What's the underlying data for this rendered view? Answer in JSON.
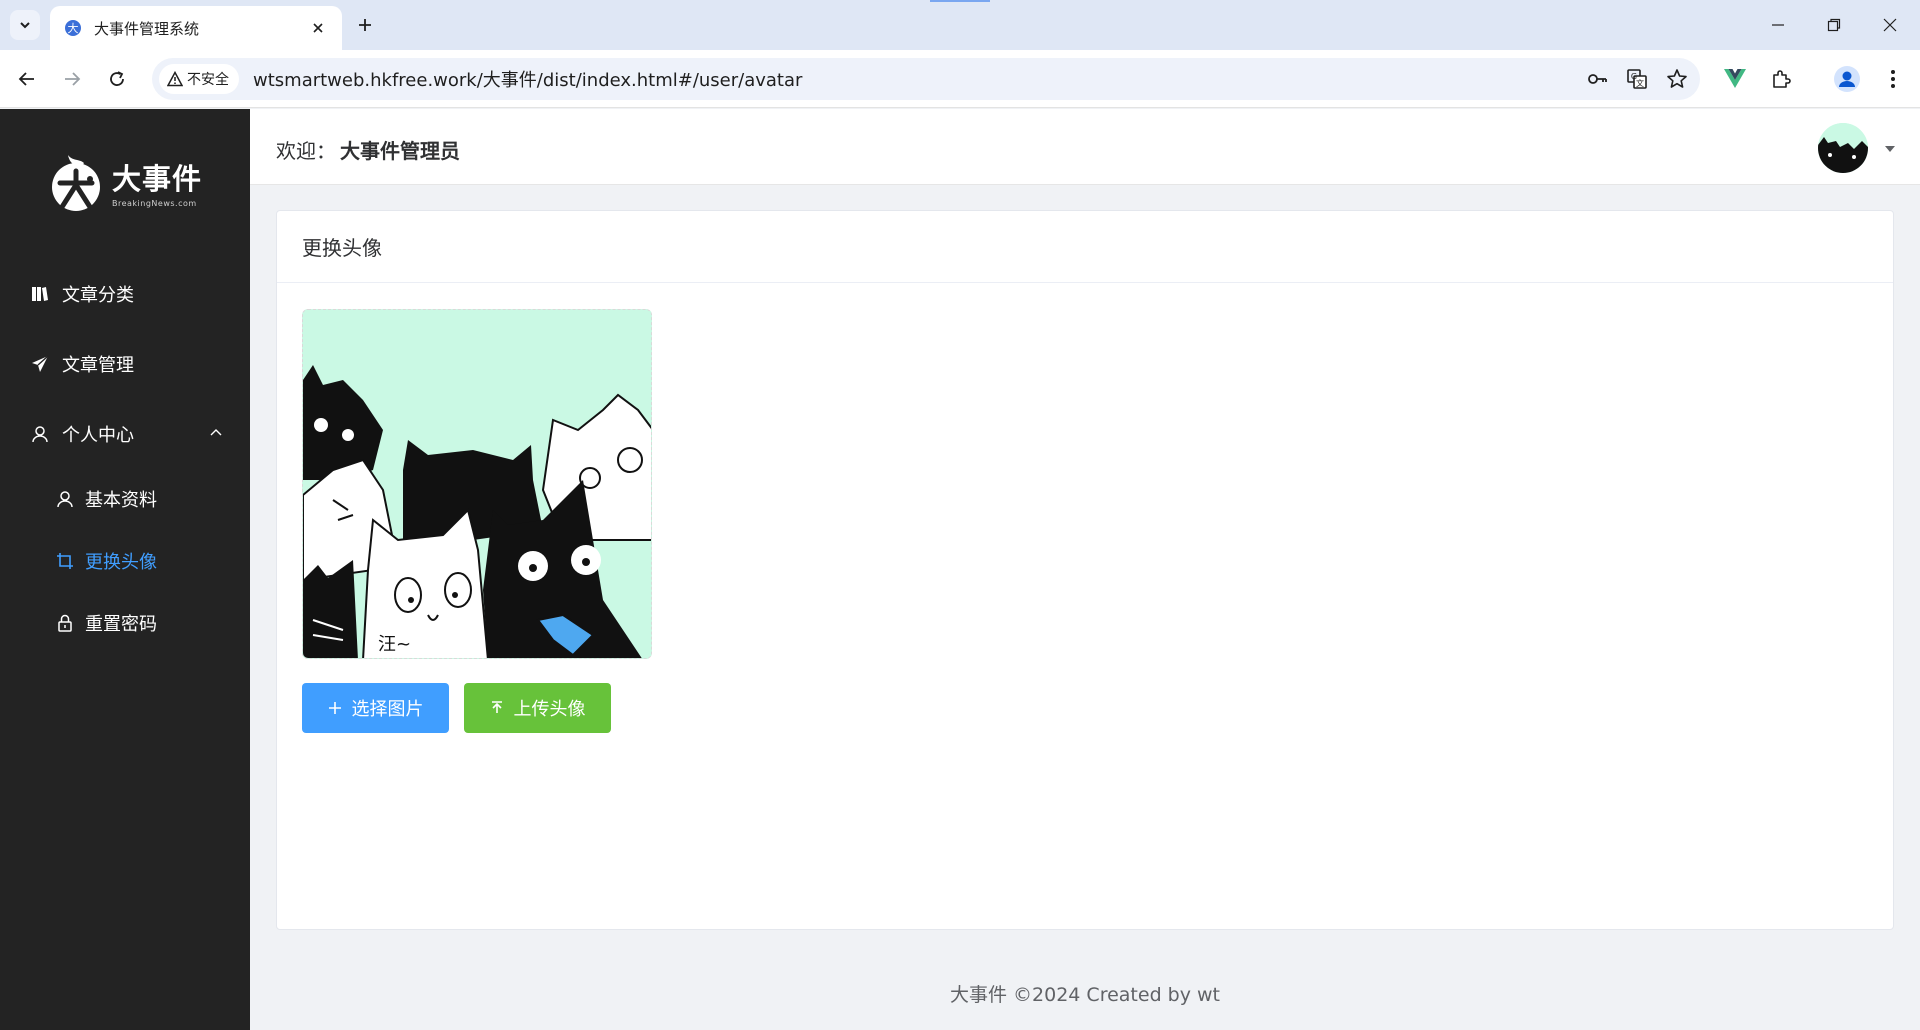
{
  "browser": {
    "tab_title": "大事件管理系统",
    "security_label": "不安全",
    "url": "wtsmartweb.hkfree.work/大事件/dist/index.html#/user/avatar"
  },
  "app": {
    "logo_title": "大事件",
    "logo_sub": "BreakingNews.com",
    "menu": [
      {
        "label": "文章分类",
        "icon": "book-icon"
      },
      {
        "label": "文章管理",
        "icon": "paper-plane-icon"
      },
      {
        "label": "个人中心",
        "icon": "user-icon",
        "expanded": true
      }
    ],
    "submenu": [
      {
        "label": "基本资料",
        "icon": "user-icon"
      },
      {
        "label": "更换头像",
        "icon": "crop-icon",
        "active": true
      },
      {
        "label": "重置密码",
        "icon": "lock-icon"
      }
    ],
    "header": {
      "welcome_prefix": "欢迎：",
      "username": "大事件管理员"
    },
    "card": {
      "title": "更换头像",
      "select_button": "选择图片",
      "upload_button": "上传头像"
    },
    "footer": "大事件 ©2024 Created by wt"
  },
  "colors": {
    "sidebar_bg": "#232323",
    "active": "#409eff",
    "primary_button": "#409eff",
    "success_button": "#67c23a",
    "avatar_bg": "#caf9e4"
  }
}
